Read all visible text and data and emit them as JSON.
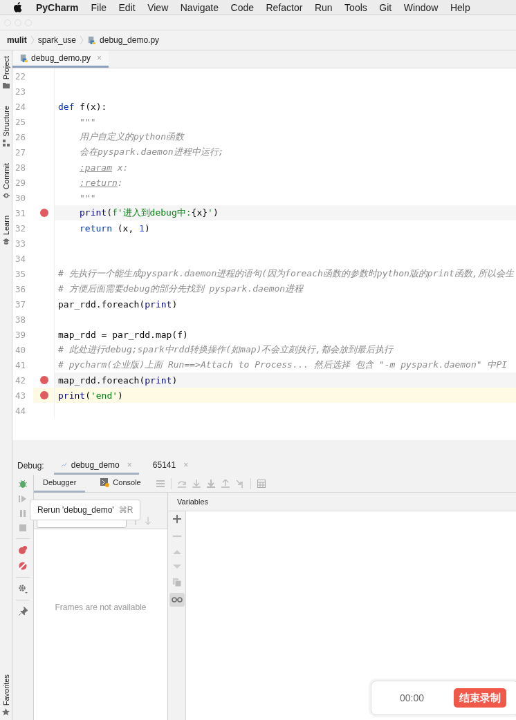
{
  "menu_bar": {
    "app": "PyCharm",
    "items": [
      "File",
      "Edit",
      "View",
      "Navigate",
      "Code",
      "Refactor",
      "Run",
      "Tools",
      "Git",
      "Window",
      "Help"
    ]
  },
  "breadcrumbs": [
    {
      "text": "mulit",
      "kind": "project"
    },
    {
      "text": "spark_use",
      "kind": "folder"
    },
    {
      "text": "debug_demo.py",
      "kind": "file"
    }
  ],
  "tool_strip": {
    "top": [
      "Project",
      "Structure",
      "Commit",
      "Learn"
    ],
    "bottom": [
      "Favorites"
    ]
  },
  "editor": {
    "tabs": [
      {
        "label": "debug_demo.py",
        "close": "×",
        "selected": true
      }
    ],
    "lines": [
      {
        "number": "22",
        "breakpoint": false,
        "current": false,
        "caret": false
      },
      {
        "number": "23",
        "breakpoint": false,
        "current": false,
        "caret": false
      },
      {
        "number": "24",
        "breakpoint": false,
        "current": false,
        "caret": false,
        "indented": false,
        "tokens": [
          {
            "kind": "keyword",
            "text": "def"
          },
          {
            "kind": "plain",
            "text": " f(x):"
          }
        ]
      },
      {
        "number": "25",
        "breakpoint": false,
        "current": false,
        "caret": false,
        "indented": true,
        "tokens": [
          {
            "kind": "comment",
            "text": "\"\"\""
          }
        ]
      },
      {
        "number": "26",
        "breakpoint": false,
        "current": false,
        "caret": false,
        "indented": true,
        "tokens": [
          {
            "kind": "comment",
            "text": "用户自定义的python函数"
          }
        ]
      },
      {
        "number": "27",
        "breakpoint": false,
        "current": false,
        "caret": false,
        "indented": true,
        "tokens": [
          {
            "kind": "comment",
            "text": "会在pyspark.daemon进程中运行;"
          }
        ]
      },
      {
        "number": "28",
        "breakpoint": false,
        "current": false,
        "caret": false,
        "indented": true,
        "tokens": [
          {
            "kind": "doctag",
            "text": ":param"
          },
          {
            "kind": "comment",
            "text": " x:"
          }
        ]
      },
      {
        "number": "29",
        "breakpoint": false,
        "current": false,
        "caret": false,
        "indented": true,
        "tokens": [
          {
            "kind": "doctag",
            "text": ":return"
          },
          {
            "kind": "comment",
            "text": ":"
          }
        ]
      },
      {
        "number": "30",
        "breakpoint": false,
        "current": false,
        "caret": false,
        "indented": true,
        "tokens": [
          {
            "kind": "comment",
            "text": "\"\"\""
          }
        ]
      },
      {
        "number": "31",
        "breakpoint": true,
        "current": true,
        "caret": false,
        "indented": true,
        "tokens": [
          {
            "kind": "builtin",
            "text": "print"
          },
          {
            "kind": "plain",
            "text": "("
          },
          {
            "kind": "string",
            "text": "f'进入到debug中:"
          },
          {
            "kind": "plain",
            "text": "{x}"
          },
          {
            "kind": "string",
            "text": "'"
          },
          {
            "kind": "plain",
            "text": ")"
          }
        ]
      },
      {
        "number": "32",
        "breakpoint": false,
        "current": false,
        "caret": false,
        "indented": true,
        "tokens": [
          {
            "kind": "keyword",
            "text": "return"
          },
          {
            "kind": "plain",
            "text": " (x, "
          },
          {
            "kind": "number",
            "text": "1"
          },
          {
            "kind": "plain",
            "text": ")"
          }
        ]
      },
      {
        "number": "33",
        "breakpoint": false,
        "current": false,
        "caret": false
      },
      {
        "number": "34",
        "breakpoint": false,
        "current": false,
        "caret": false
      },
      {
        "number": "35",
        "breakpoint": false,
        "current": false,
        "caret": false,
        "indented": false,
        "tokens": [
          {
            "kind": "comment",
            "text": "# 先执行一个能生成pyspark.daemon进程的语句(因为foreach函数的参数时python版的print函数,所以会生"
          }
        ]
      },
      {
        "number": "36",
        "breakpoint": false,
        "current": false,
        "caret": false,
        "indented": false,
        "tokens": [
          {
            "kind": "comment",
            "text": "# 方便后面需要debug的部分先找到 pyspark.daemon进程"
          }
        ]
      },
      {
        "number": "37",
        "breakpoint": false,
        "current": false,
        "caret": false,
        "indented": false,
        "tokens": [
          {
            "kind": "plain",
            "text": "par_rdd.foreach("
          },
          {
            "kind": "builtin",
            "text": "print"
          },
          {
            "kind": "plain",
            "text": ")"
          }
        ]
      },
      {
        "number": "38",
        "breakpoint": false,
        "current": false,
        "caret": false
      },
      {
        "number": "39",
        "breakpoint": false,
        "current": false,
        "caret": false,
        "indented": false,
        "tokens": [
          {
            "kind": "plain",
            "text": "map_rdd = par_rdd.map(f)"
          }
        ]
      },
      {
        "number": "40",
        "breakpoint": false,
        "current": false,
        "caret": false,
        "indented": false,
        "tokens": [
          {
            "kind": "comment",
            "text": "# 此处进行debug;spark中rdd转换操作(如map)不会立刻执行,都会放到最后执行"
          }
        ]
      },
      {
        "number": "41",
        "breakpoint": false,
        "current": false,
        "caret": false,
        "indented": false,
        "tokens": [
          {
            "kind": "comment",
            "text": "# pycharm(企业版)上面 Run==>Attach to Process... 然后选择 包含 \"-m pyspark.daemon\" 中PI"
          }
        ]
      },
      {
        "number": "42",
        "breakpoint": true,
        "current": true,
        "caret": false,
        "indented": false,
        "tokens": [
          {
            "kind": "plain",
            "text": "map_rdd.foreach("
          },
          {
            "kind": "builtin",
            "text": "print"
          },
          {
            "kind": "plain",
            "text": ")"
          }
        ]
      },
      {
        "number": "43",
        "breakpoint": true,
        "current": false,
        "caret": true,
        "indented": false,
        "tokens": [
          {
            "kind": "builtin",
            "text": "print"
          },
          {
            "kind": "plain",
            "text": "("
          },
          {
            "kind": "string",
            "text": "'end'"
          },
          {
            "kind": "plain",
            "text": ")"
          }
        ]
      },
      {
        "number": "44",
        "breakpoint": false,
        "current": false,
        "caret": false
      }
    ]
  },
  "debug": {
    "label": "Debug:",
    "sessions": [
      {
        "label": "debug_demo",
        "close": "×",
        "selected": true
      },
      {
        "label": "65141",
        "close": "×",
        "selected": false
      }
    ],
    "tabs": [
      {
        "label": "Debugger",
        "selected": true
      },
      {
        "label": "Console",
        "selected": false
      }
    ],
    "frames": {
      "empty_text": "Frames are not available"
    },
    "variables": {
      "title": "Variables"
    },
    "tooltip": {
      "text": "Rerun 'debug_demo'",
      "shortcut": "⌘R"
    }
  },
  "recorder": {
    "time": "00:00",
    "stop_button": "结束录制"
  }
}
